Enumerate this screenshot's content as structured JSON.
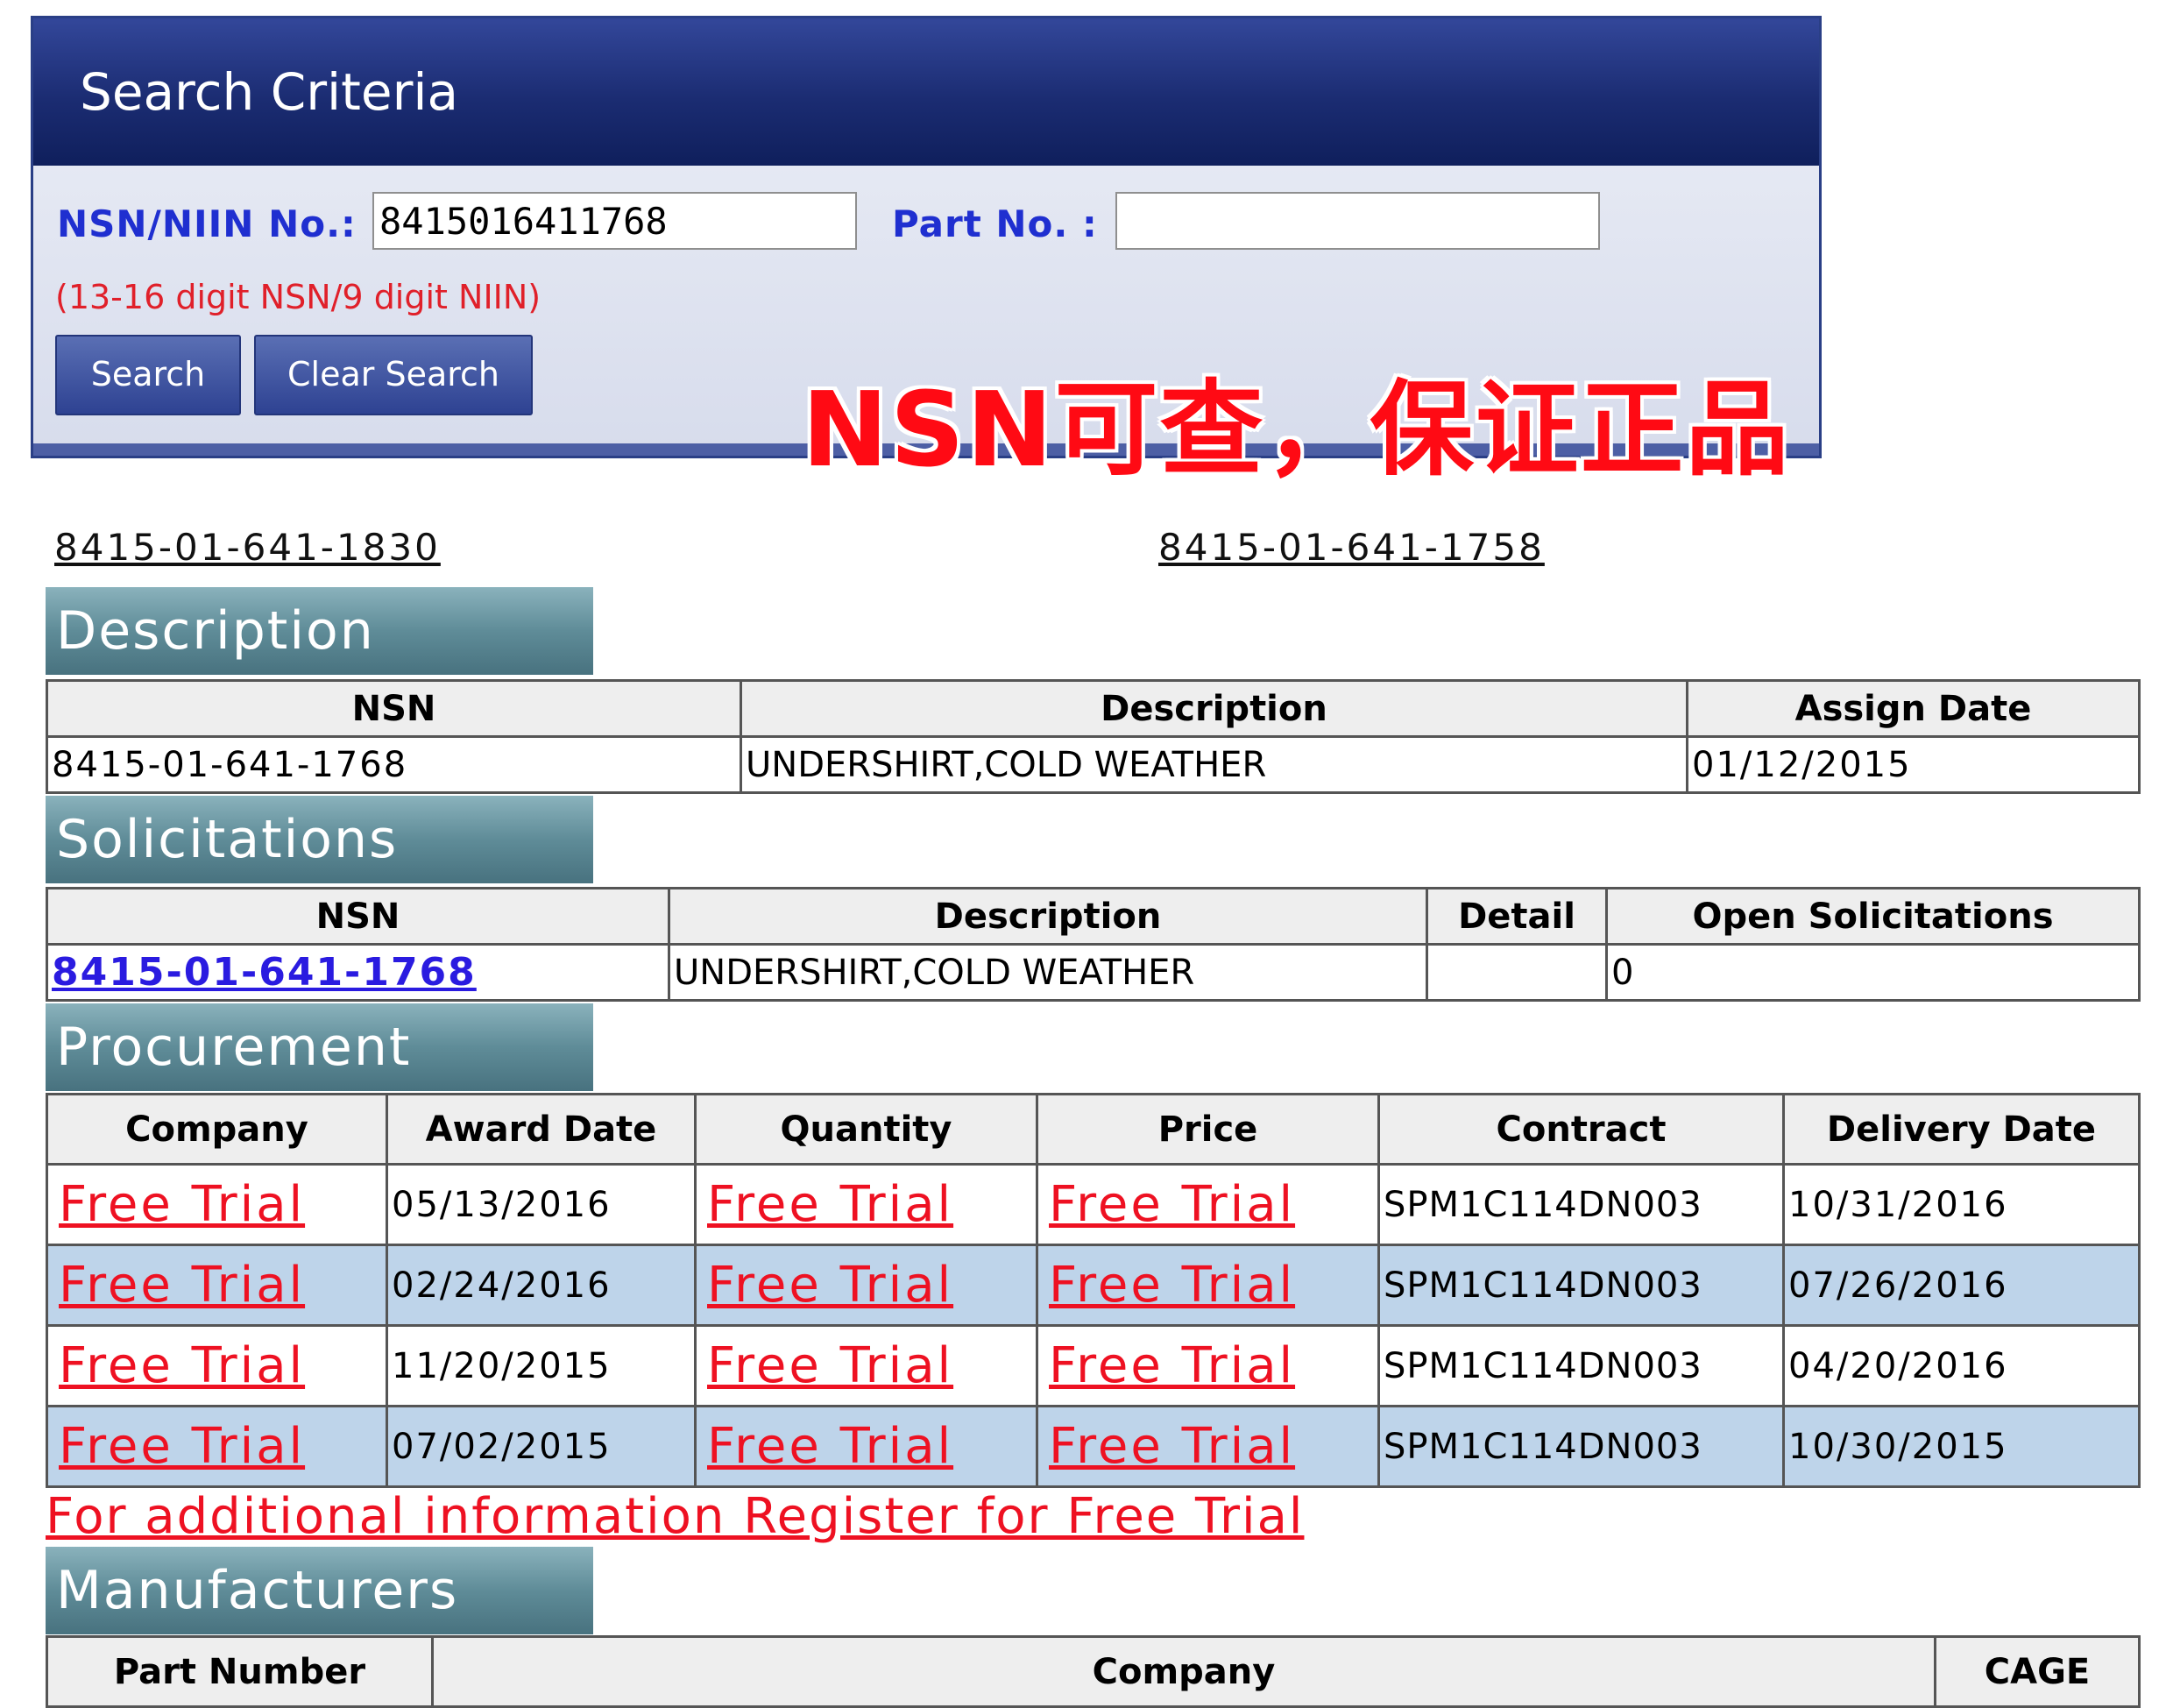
{
  "search": {
    "title": "Search Criteria",
    "nsn_label": "NSN/NIIN No.:",
    "nsn_value": "8415016411768",
    "part_label": "Part No. :",
    "part_value": "",
    "hint": "(13-16 digit NSN/9 digit NIIN)",
    "search_button": "Search",
    "clear_button": "Clear Search"
  },
  "overlay_text": "NSN可查，保证正品",
  "nav_links": {
    "left": "8415-01-641-1830",
    "right": "8415-01-641-1758"
  },
  "description": {
    "title": "Description",
    "headers": [
      "NSN",
      "Description",
      "Assign Date"
    ],
    "row": [
      "8415-01-641-1768",
      "UNDERSHIRT,COLD WEATHER",
      "01/12/2015"
    ]
  },
  "solicitations": {
    "title": "Solicitations",
    "headers": [
      "NSN",
      "Description",
      "Detail",
      "Open Solicitations"
    ],
    "row": [
      "8415-01-641-1768",
      "UNDERSHIRT,COLD WEATHER",
      "",
      "0"
    ]
  },
  "procurement": {
    "title": "Procurement",
    "headers": [
      "Company",
      "Award Date",
      "Quantity",
      "Price",
      "Contract",
      "Delivery Date"
    ],
    "rows": [
      [
        "Free Trial",
        "05/13/2016",
        "Free Trial",
        "Free Trial",
        "SPM1C114DN003",
        "10/31/2016"
      ],
      [
        "Free Trial",
        "02/24/2016",
        "Free Trial",
        "Free Trial",
        "SPM1C114DN003",
        "07/26/2016"
      ],
      [
        "Free Trial",
        "11/20/2015",
        "Free Trial",
        "Free Trial",
        "SPM1C114DN003",
        "04/20/2016"
      ],
      [
        "Free Trial",
        "07/02/2015",
        "Free Trial",
        "Free Trial",
        "SPM1C114DN003",
        "10/30/2015"
      ]
    ],
    "register_link": "For additional information Register for Free Trial"
  },
  "manufacturers": {
    "title": "Manufacturers",
    "headers": [
      "Part Number",
      "Company",
      "CAGE"
    ]
  },
  "colors": {
    "header_navy": "#1b2c72",
    "label_blue": "#1f2fd0",
    "link_red": "#ee1122",
    "section_teal": "#5f8c98",
    "alt_row": "#bed4ea"
  }
}
